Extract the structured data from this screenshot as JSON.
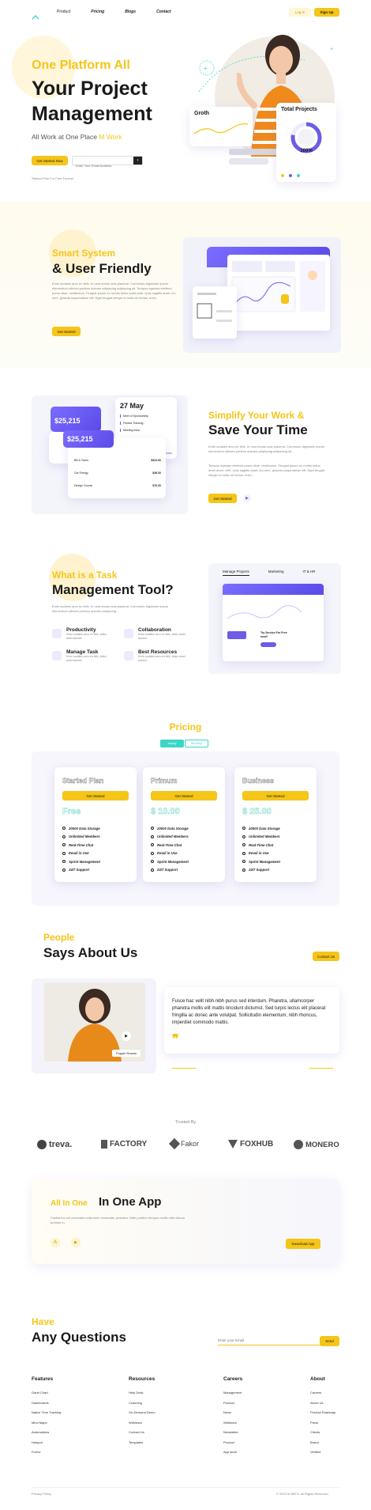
{
  "nav": {
    "items": [
      "Product",
      "Pricing",
      "Blogs",
      "Contact"
    ],
    "login": "Log In",
    "signup": "Sign Up"
  },
  "hero": {
    "line1": "One Platform All",
    "line2": "Your Project",
    "line3": "Management",
    "sub_prefix": "All Work at One Place ",
    "sub_highlight": "M Work",
    "cta": "Get Started Now",
    "email_placeholder": "Enter Your Email Address",
    "note": "Started Plan For Free Forever",
    "growth_title": "Groth",
    "projects_title": "Total Projects",
    "projects_value": "100%",
    "projects_progress": 0.78
  },
  "s1": {
    "eyebrow": "Smart System",
    "title": "& User Friendly",
    "body": "Enim sodales arcu eu felis. In urna lectus cras placerat. Commodo dignissim ipsum elementum ultrices pretium dolores adipiscing adipiscing sit. Tempus egestas eleifend purus vitae, vestibulum. Feugiat ipsum eu mortis tellus amet ante. Quis sagittis amet, leo sem, gravida suspendisse elit. Eget feugiat integer id nulla vel lectus, enim.",
    "cta": "Get Started"
  },
  "s2": {
    "balance": "$25,215",
    "balance2": "$25,215",
    "date": "27 May",
    "events": [
      "Meet of Sponsorship",
      "Fitness Tracking",
      "Meeting Infos"
    ],
    "view_all": "View all Tasks",
    "tx": [
      {
        "name": "Bill & Taxes",
        "amount": "$324.00"
      },
      {
        "name": "Car Energy",
        "amount": "$46.00"
      },
      {
        "name": "Design Course",
        "amount": "$70.00"
      }
    ],
    "eyebrow": "Simplify Your Work &",
    "title": "Save Your Time",
    "body1": "Enim sodales arcu eu felis. In urna lectus cras placerat. Commodo dignissim ipsum elementum ultrices pretium dolores adipiscing adipiscing sit.",
    "body2": "Tempus egestas eleifend purus vitae, vestibulum. Feugiat ipsum eu mortis tellus amet amet. velit. Quis sagittis amet, leo sem, gravida suspendisse elit. Eget feugiat integer id nulla vel lectus, enim.",
    "cta": "Get Started"
  },
  "s3": {
    "eyebrow": "What is a Task",
    "title": "Management Tool?",
    "body": "Enim sodales arcu eu felis. In urna lectus cras placerat. Commodo dignissim ipsum elementum ultrices pretium dolores adipiscing.",
    "features": [
      {
        "title": "Productivity",
        "desc": "Enim sodales arcu eu felis, tellus amet laoreet."
      },
      {
        "title": "Collaboration",
        "desc": "Enim sodales arcu eu felis, tellus amet laoreet."
      },
      {
        "title": "Manage Task",
        "desc": "Enim sodales arcu eu felis, tellus amet laoreet."
      },
      {
        "title": "Best Resources",
        "desc": "Enim sodales arcu eu felis, tellus amet laoreet."
      }
    ],
    "tabs": [
      "Manage Projects",
      "Marketing",
      "IT & HR"
    ],
    "promo": "Try Service For Free now!!"
  },
  "pricing": {
    "title": "Pricing",
    "toggle": [
      "Yearly",
      "Monthly"
    ],
    "plans": [
      {
        "name": "Started Plan",
        "price": "Free",
        "cta": "Get Started"
      },
      {
        "name": "Primum",
        "price": "$ 10.00",
        "cta": "Get Started"
      },
      {
        "name": "Business",
        "price": "$ 25.00",
        "cta": "Get Started"
      }
    ],
    "features": [
      "20000 Data Storage",
      "Unlimited Members",
      "Real-Time Chat",
      "Email in Use",
      "Sprint Management",
      "24/7 Support"
    ]
  },
  "testimonial": {
    "eyebrow": "People",
    "title": "Says About Us",
    "cta": "Contact Us",
    "person": "Poppin Rowan",
    "quote": "Fusce hac velit nibh nibh purus sed interdum. Pharetra, ullamcorper pharetra mollis elit mattis tincidunt dictumst. Sed turpis lectus elit placerat fringilla ac donec ante volutpat. Sollicitudin elementum, nibh rhoncus, imperdiet commodo mattis."
  },
  "trusted": {
    "label": "Trusted By",
    "logos": [
      "treva.",
      "FACTORY",
      "Fakor",
      "FOXHUB",
      "MONERO"
    ]
  },
  "app": {
    "prefix": "All In One",
    "title": "In One App",
    "body": "Facilisi leo vel venenatis nulla enim venenatis, pharetra. Nibh porttitor tempus mollis nibh dictum pretium in.",
    "cta": "Download App"
  },
  "faq": {
    "eyebrow": "Have",
    "title": "Any Questions",
    "placeholder": "Enter your Email",
    "cta": "Send"
  },
  "footer": {
    "cols": [
      {
        "title": "Features",
        "items": [
          "Gantt Chart",
          "Dashboards",
          "Native Time Tracking",
          "Mind Maps",
          "Automations",
          "Hotspot",
          "Forms"
        ]
      },
      {
        "title": "Resources",
        "items": [
          "Help Desk",
          "Coaching",
          "On-Demand Demo",
          "Webinars",
          "Contact Us",
          "Templates"
        ]
      },
      {
        "title": "Careers",
        "items": [
          "Management",
          "Product",
          "News",
          "Webinars",
          "Newsletter",
          "Product",
          "App store"
        ]
      },
      {
        "title": "About",
        "items": [
          "Careers",
          "About Us",
          "Product Roadmap",
          "Press",
          "Clients",
          "Brand",
          "Verified"
        ]
      }
    ],
    "privacy": "Privacy Policy",
    "copyright": "© 2022 M WRTL All Rights Reserved"
  },
  "colors": {
    "accent": "#f5c518",
    "purple": "#6c5ce7",
    "teal": "#3dd6c6"
  }
}
